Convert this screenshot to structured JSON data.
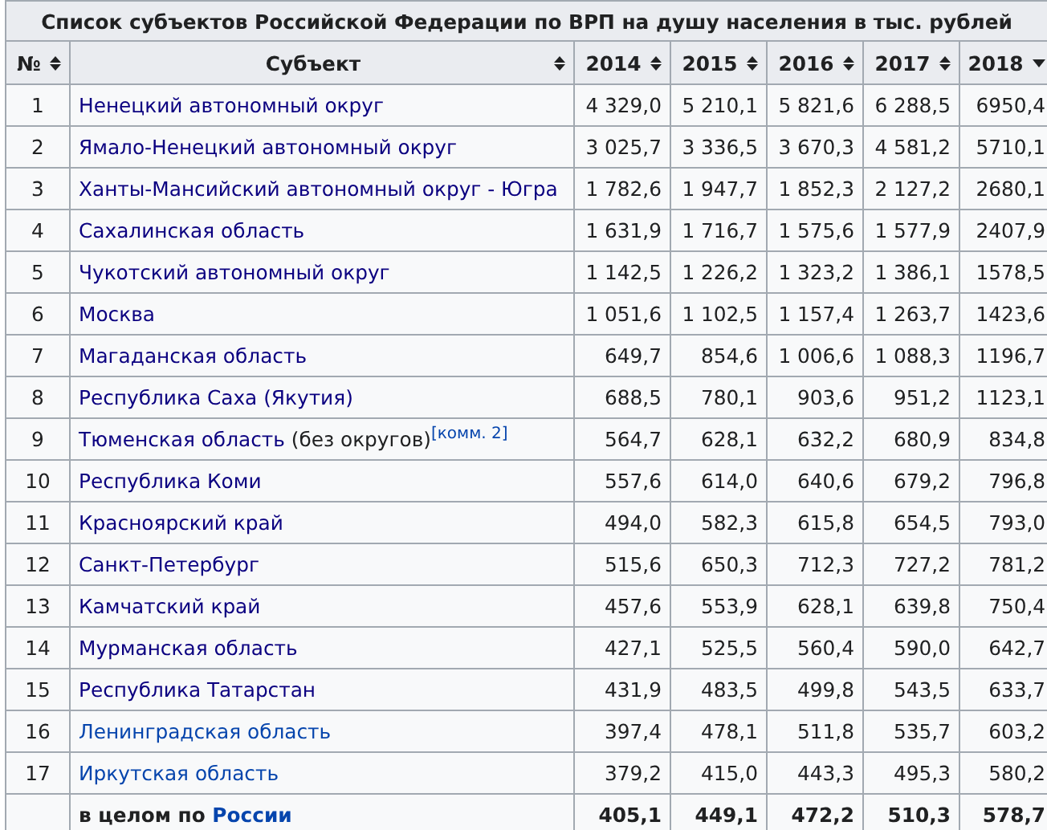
{
  "title": "Список субъектов Российской Федерации по ВРП на душу населения в тыс. рублей",
  "columns": [
    {
      "label": "№",
      "sorted": false
    },
    {
      "label": "Субъект",
      "sorted": false
    },
    {
      "label": "2014",
      "sorted": false
    },
    {
      "label": "2015",
      "sorted": false
    },
    {
      "label": "2016",
      "sorted": false
    },
    {
      "label": "2017",
      "sorted": false
    },
    {
      "label": "2018",
      "sorted": true
    }
  ],
  "rows": [
    {
      "rank": "1",
      "name": "Ненецкий автономный округ",
      "visited": true,
      "values": [
        "4 329,0",
        "5 210,1",
        "5 821,6",
        "6 288,5",
        "6950,4"
      ]
    },
    {
      "rank": "2",
      "name": "Ямало-Ненецкий автономный округ",
      "visited": true,
      "values": [
        "3 025,7",
        "3 336,5",
        "3 670,3",
        "4 581,2",
        "5710,1"
      ]
    },
    {
      "rank": "3",
      "name": "Ханты-Мансийский автономный округ - Югра",
      "visited": true,
      "values": [
        "1 782,6",
        "1 947,7",
        "1 852,3",
        "2 127,2",
        "2680,1"
      ]
    },
    {
      "rank": "4",
      "name": "Сахалинская область",
      "visited": true,
      "values": [
        "1 631,9",
        "1 716,7",
        "1 575,6",
        "1 577,9",
        "2407,9"
      ]
    },
    {
      "rank": "5",
      "name": "Чукотский автономный округ",
      "visited": true,
      "values": [
        "1 142,5",
        "1 226,2",
        "1 323,2",
        "1 386,1",
        "1578,5"
      ]
    },
    {
      "rank": "6",
      "name": "Москва",
      "visited": true,
      "values": [
        "1 051,6",
        "1 102,5",
        "1 157,4",
        "1 263,7",
        "1423,6"
      ]
    },
    {
      "rank": "7",
      "name": "Магаданская область",
      "visited": true,
      "values": [
        "649,7",
        "854,6",
        "1 006,6",
        "1 088,3",
        "1196,7"
      ]
    },
    {
      "rank": "8",
      "name": "Республика Саха (Якутия)",
      "visited": true,
      "values": [
        "688,5",
        "780,1",
        "903,6",
        "951,2",
        "1123,1"
      ]
    },
    {
      "rank": "9",
      "name": "Тюменская область",
      "suffix": " (без округов)",
      "note": "[комм. 2]",
      "visited": true,
      "values": [
        "564,7",
        "628,1",
        "632,2",
        "680,9",
        "834,8"
      ]
    },
    {
      "rank": "10",
      "name": "Республика Коми",
      "visited": true,
      "values": [
        "557,6",
        "614,0",
        "640,6",
        "679,2",
        "796,8"
      ]
    },
    {
      "rank": "11",
      "name": "Красноярский край",
      "visited": true,
      "values": [
        "494,0",
        "582,3",
        "615,8",
        "654,5",
        "793,0"
      ]
    },
    {
      "rank": "12",
      "name": "Санкт-Петербург",
      "visited": true,
      "values": [
        "515,6",
        "650,3",
        "712,3",
        "727,2",
        "781,2"
      ]
    },
    {
      "rank": "13",
      "name": "Камчатский край",
      "visited": true,
      "values": [
        "457,6",
        "553,9",
        "628,1",
        "639,8",
        "750,4"
      ]
    },
    {
      "rank": "14",
      "name": "Мурманская область",
      "visited": true,
      "values": [
        "427,1",
        "525,5",
        "560,4",
        "590,0",
        "642,7"
      ]
    },
    {
      "rank": "15",
      "name": "Республика Татарстан",
      "visited": true,
      "values": [
        "431,9",
        "483,5",
        "499,8",
        "543,5",
        "633,7"
      ]
    },
    {
      "rank": "16",
      "name": "Ленинградская область",
      "visited": false,
      "values": [
        "397,4",
        "478,1",
        "511,8",
        "535,7",
        "603,2"
      ]
    },
    {
      "rank": "17",
      "name": "Иркутская область",
      "visited": false,
      "values": [
        "379,2",
        "415,0",
        "443,3",
        "495,3",
        "580,2"
      ]
    }
  ],
  "total": {
    "prefix": "в целом по ",
    "link": "России",
    "values": [
      "405,1",
      "449,1",
      "472,2",
      "510,3",
      "578,7"
    ]
  }
}
